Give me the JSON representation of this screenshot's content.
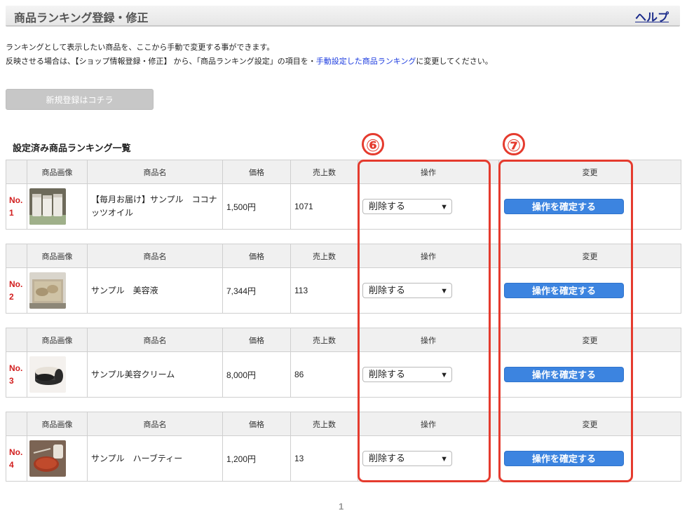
{
  "header": {
    "title": "商品ランキング登録・修正",
    "help": "ヘルプ"
  },
  "intro": {
    "line1": "ランキングとして表示したい商品を、ここから手動で変更する事ができます。",
    "line2_prefix": "反映させる場合は、【ショップ情報登録・修正】 から、「商品ランキング設定」の項目を・",
    "line2_link": "手動設定した商品ランキング",
    "line2_suffix": "に変更してください。"
  },
  "new_button": "新規登録はコチラ",
  "list_title": "設定済み商品ランキング一覧",
  "columns": {
    "image": "商品画像",
    "name": "商品名",
    "price": "価格",
    "sales": "売上数",
    "operation": "操作",
    "change": "変更"
  },
  "rows": [
    {
      "rank": "No.",
      "rank_num": "1",
      "name": "【毎月お届け】サンプル　ココナッツオイル",
      "price": "1,500円",
      "sales": "1071",
      "operation": "削除する",
      "confirm": "操作を確定する",
      "thumb_icon": "coconut-oil-jars-icon"
    },
    {
      "rank": "No.",
      "rank_num": "2",
      "name": "サンプル　美容液",
      "price": "7,344円",
      "sales": "113",
      "operation": "削除する",
      "confirm": "操作を確定する",
      "thumb_icon": "serum-tray-icon"
    },
    {
      "rank": "No.",
      "rank_num": "3",
      "name": "サンプル美容クリーム",
      "price": "8,000円",
      "sales": "86",
      "operation": "削除する",
      "confirm": "操作を確定する",
      "thumb_icon": "cream-jar-icon"
    },
    {
      "rank": "No.",
      "rank_num": "4",
      "name": "サンプル　ハーブティー",
      "price": "1,200円",
      "sales": "13",
      "operation": "削除する",
      "confirm": "操作を確定する",
      "thumb_icon": "herb-tea-icon"
    }
  ],
  "annotations": {
    "six": "⑥",
    "seven": "⑦"
  },
  "pager": "1",
  "colors": {
    "accent_blue": "#3c84e0",
    "highlight_red": "#e53b2e",
    "rank_red": "#d21f1f",
    "link_blue": "#1a3adf"
  }
}
